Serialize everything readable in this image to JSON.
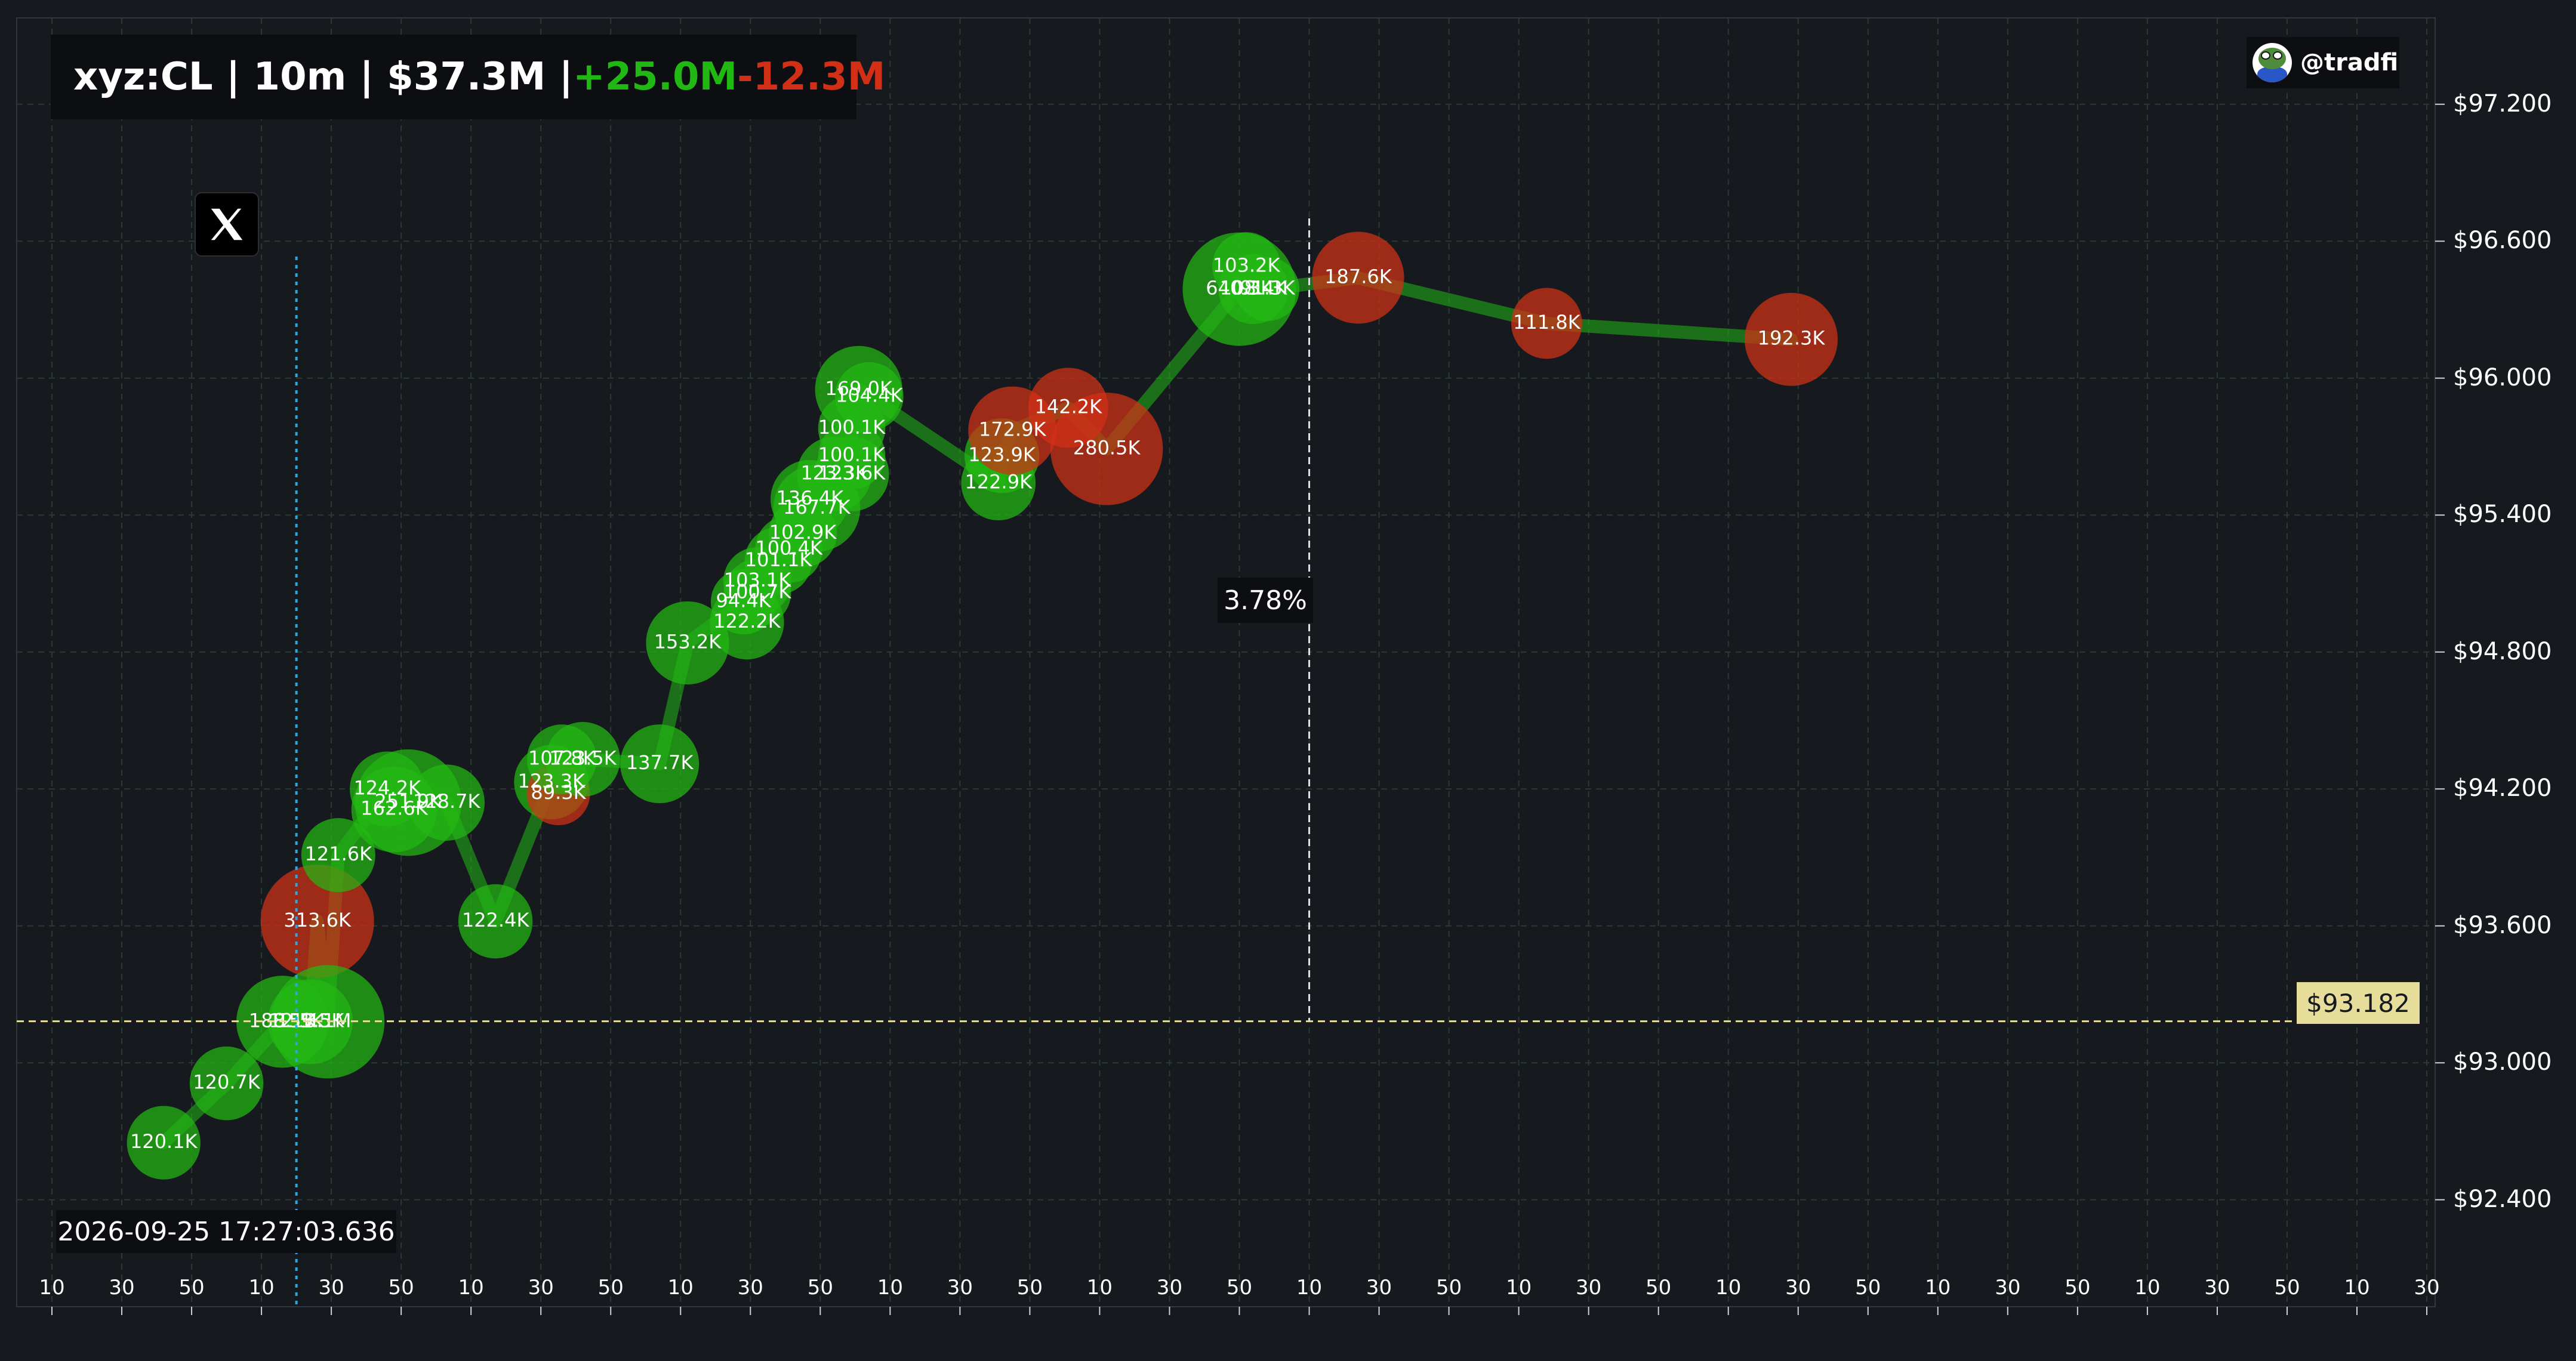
{
  "header": {
    "symbol_line": "xyz:CL | 10m | $37.3M | ",
    "buy_total": "+25.0M",
    "sell_total": "-12.3M"
  },
  "handle": "@tradfi",
  "timestamp": "2026-09-25 17:27:03.636",
  "change_pct": "3.78%",
  "current_price_label": "$93.182",
  "colors": {
    "background": "#161a1f",
    "buy": "#22b814",
    "sell": "#d23016",
    "tweet_marker_line": "#2aa9e0",
    "crosshair": "#e6dd9a",
    "grid": "#2a3a30"
  },
  "icons": {
    "tweet_marker": "x-logo-icon",
    "avatar": "pepe-avatar-icon"
  },
  "chart_data": {
    "type": "scatter",
    "title": "xyz:CL | 10m | $37.3M | +25.0M-12.3M",
    "y_ticks": [
      "$97.200",
      "$96.600",
      "$96.000",
      "$95.400",
      "$94.800",
      "$94.200",
      "$93.600",
      "$93.000",
      "$92.400"
    ],
    "y_tick_values": [
      97.2,
      96.6,
      96.0,
      95.4,
      94.8,
      94.2,
      93.6,
      93.0,
      92.4
    ],
    "ylim": [
      91.8,
      97.45
    ],
    "x_ticks": [
      "10",
      "30",
      "50",
      "10",
      "30",
      "50",
      "10",
      "30",
      "50",
      "10",
      "30",
      "50",
      "10",
      "30",
      "50",
      "10",
      "30",
      "50",
      "10",
      "30",
      "50",
      "10",
      "30",
      "50",
      "10",
      "30",
      "50",
      "10",
      "30",
      "50",
      "10",
      "30",
      "50",
      "10",
      "30"
    ],
    "x_tick_count": 35,
    "grid": true,
    "current_price": 93.182,
    "tweet_marker_x": 3.5,
    "change_marker": {
      "x": 18,
      "from": 93.182,
      "to": 96.7,
      "label": "3.78%"
    },
    "labeled_trades": [
      {
        "x": 1.6,
        "y": 92.65,
        "label": "120.1K",
        "side": "buy",
        "size": 120.1
      },
      {
        "x": 2.5,
        "y": 92.91,
        "label": "120.7K",
        "side": "buy",
        "size": 120.7
      },
      {
        "x": 3.3,
        "y": 93.18,
        "label": "188.1K",
        "side": "buy",
        "size": 188.1
      },
      {
        "x": 3.5,
        "y": 93.18,
        "label": "12.5K",
        "side": "buy",
        "size": 12.5
      },
      {
        "x": 3.7,
        "y": 93.18,
        "label": "159.5K",
        "side": "buy",
        "size": 159.5
      },
      {
        "x": 3.95,
        "y": 93.18,
        "label": "3.1M",
        "side": "buy",
        "size": 3100
      },
      {
        "x": 3.8,
        "y": 93.62,
        "label": "313.6K",
        "side": "sell",
        "size": 313.6
      },
      {
        "x": 4.1,
        "y": 93.91,
        "label": "121.6K",
        "side": "buy",
        "size": 121.6
      },
      {
        "x": 4.9,
        "y": 94.11,
        "label": "162.6K",
        "side": "buy",
        "size": 162.6
      },
      {
        "x": 5.1,
        "y": 94.14,
        "label": "251.9K",
        "side": "buy",
        "size": 251.9
      },
      {
        "x": 5.65,
        "y": 94.14,
        "label": "128.7K",
        "side": "buy",
        "size": 128.7
      },
      {
        "x": 4.8,
        "y": 94.2,
        "label": "124.2K",
        "side": "buy",
        "size": 124.2
      },
      {
        "x": 6.35,
        "y": 93.62,
        "label": "122.4K",
        "side": "buy",
        "size": 122.4
      },
      {
        "x": 7.15,
        "y": 94.23,
        "label": "123.3K",
        "side": "buy",
        "size": 123.3
      },
      {
        "x": 7.25,
        "y": 94.18,
        "label": "89.3K",
        "side": "sell",
        "size": 89.3
      },
      {
        "x": 7.3,
        "y": 94.33,
        "label": "107.8K",
        "side": "buy",
        "size": 107.8
      },
      {
        "x": 7.6,
        "y": 94.33,
        "label": "123.5K",
        "side": "buy",
        "size": 123.5
      },
      {
        "x": 8.7,
        "y": 94.31,
        "label": "137.7K",
        "side": "buy",
        "size": 137.7
      },
      {
        "x": 9.1,
        "y": 94.84,
        "label": "153.2K",
        "side": "buy",
        "size": 153.2
      },
      {
        "x": 9.95,
        "y": 94.93,
        "label": "122.2K",
        "side": "buy",
        "size": 122.2
      },
      {
        "x": 9.9,
        "y": 95.02,
        "label": "94.4K",
        "side": "buy",
        "size": 94.4
      },
      {
        "x": 10.1,
        "y": 95.06,
        "label": "100.7K",
        "side": "buy",
        "size": 100.7
      },
      {
        "x": 10.1,
        "y": 95.11,
        "label": "103.1K",
        "side": "buy",
        "size": 103.1
      },
      {
        "x": 10.4,
        "y": 95.2,
        "label": "101.1K",
        "side": "buy",
        "size": 101.1
      },
      {
        "x": 10.55,
        "y": 95.25,
        "label": "100.4K",
        "side": "buy",
        "size": 100.4
      },
      {
        "x": 10.75,
        "y": 95.32,
        "label": "102.9K",
        "side": "buy",
        "size": 102.9
      },
      {
        "x": 10.95,
        "y": 95.43,
        "label": "167.7K",
        "side": "buy",
        "size": 167.7
      },
      {
        "x": 10.85,
        "y": 95.47,
        "label": "136.4K",
        "side": "buy",
        "size": 136.4
      },
      {
        "x": 11.2,
        "y": 95.58,
        "label": "123.3K",
        "side": "buy",
        "size": 123.3
      },
      {
        "x": 11.45,
        "y": 95.58,
        "label": "123.6K",
        "side": "buy",
        "size": 123.6
      },
      {
        "x": 11.45,
        "y": 95.66,
        "label": "100.1K",
        "side": "buy",
        "size": 100.1
      },
      {
        "x": 11.45,
        "y": 95.78,
        "label": "100.1K",
        "side": "buy",
        "size": 100.1
      },
      {
        "x": 11.7,
        "y": 95.92,
        "label": "104.4K",
        "side": "buy",
        "size": 104.4
      },
      {
        "x": 11.55,
        "y": 95.95,
        "label": "169.0K",
        "side": "buy",
        "size": 169.0
      },
      {
        "x": 13.55,
        "y": 95.54,
        "label": "122.9K",
        "side": "buy",
        "size": 122.9
      },
      {
        "x": 13.6,
        "y": 95.66,
        "label": "123.9K",
        "side": "buy",
        "size": 123.9
      },
      {
        "x": 13.75,
        "y": 95.77,
        "label": "172.9K",
        "side": "sell",
        "size": 172.9
      },
      {
        "x": 14.55,
        "y": 95.87,
        "label": "142.2K",
        "side": "sell",
        "size": 142.2
      },
      {
        "x": 15.1,
        "y": 95.69,
        "label": "280.5K",
        "side": "sell",
        "size": 280.5
      },
      {
        "x": 17.0,
        "y": 96.39,
        "label": "640.3K",
        "side": "buy",
        "size": 640.3
      },
      {
        "x": 17.2,
        "y": 96.39,
        "label": "108.4K",
        "side": "buy",
        "size": 108.4
      },
      {
        "x": 17.4,
        "y": 96.39,
        "label": "91.3K",
        "side": "buy",
        "size": 91.3
      },
      {
        "x": 17.1,
        "y": 96.49,
        "label": "103.2K",
        "side": "buy",
        "size": 103.2
      },
      {
        "x": 18.7,
        "y": 96.44,
        "label": "187.6K",
        "side": "sell",
        "size": 187.6
      },
      {
        "x": 21.4,
        "y": 96.24,
        "label": "111.8K",
        "side": "sell",
        "size": 111.8
      },
      {
        "x": 24.9,
        "y": 96.17,
        "label": "192.3K",
        "side": "sell",
        "size": 192.3
      }
    ]
  }
}
